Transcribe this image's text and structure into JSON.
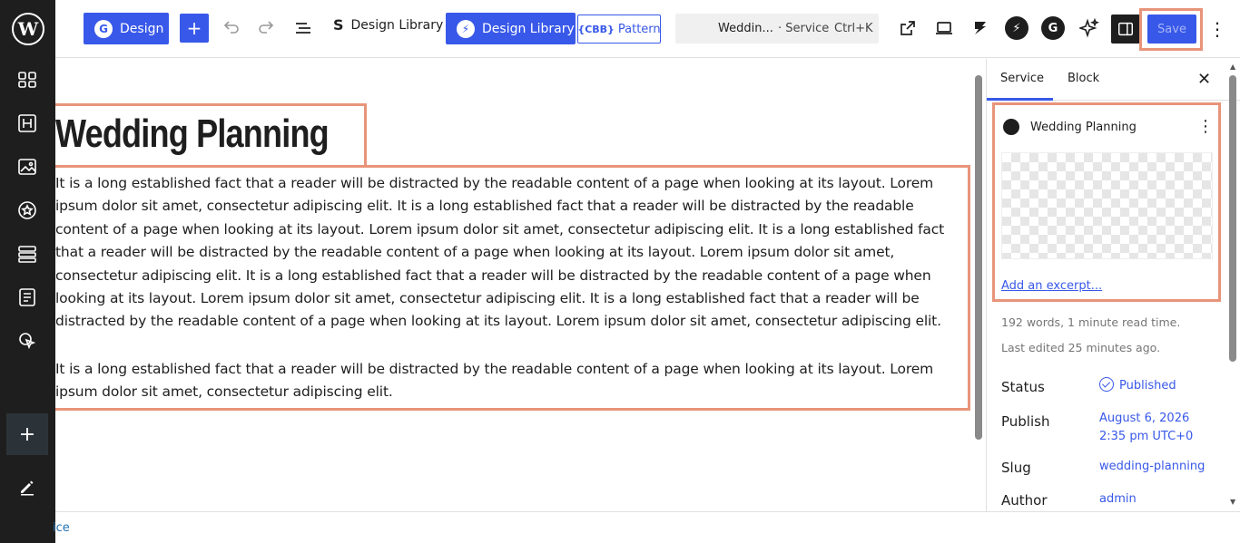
{
  "toolbar": {
    "design_label": "Design",
    "design_library_label": "Design Library",
    "design_library_active_label": "Design Library",
    "pattern_label": "Pattern",
    "pattern_prefix": "CBB",
    "command": {
      "title": "Weddin...",
      "type": "· Service",
      "shortcut": "Ctrl+K"
    },
    "save_label": "Save"
  },
  "editor": {
    "heading": "Wedding Planning",
    "paragraph1": "It is a long established fact that a reader will be distracted by the readable content of a page when looking at its layout. Lorem ipsum dolor sit amet, consectetur adipiscing elit. It is a long established fact that a reader will be distracted by the readable content of a page when looking at its layout. Lorem ipsum dolor sit amet, consectetur adipiscing elit. It is a long established fact that a reader will be distracted by the readable content of a page when looking at its layout. Lorem ipsum dolor sit amet, consectetur adipiscing elit. It is a long established fact that a reader will be distracted by the readable content of a page when looking at its layout. Lorem ipsum dolor sit amet, consectetur adipiscing elit. It is a long established fact that a reader will be distracted by the readable content of a page when looking at its layout. Lorem ipsum dolor sit amet, consectetur adipiscing elit.",
    "paragraph2": "It is a long established fact that a reader will be distracted by the readable content of a page when looking at its layout. Lorem ipsum dolor sit amet, consectetur adipiscing elit."
  },
  "footer": {
    "breadcrumb": "ice"
  },
  "panel": {
    "tabs": [
      {
        "label": "Service"
      },
      {
        "label": "Block"
      }
    ],
    "card_title": "Wedding Planning",
    "excerpt_link": "Add an excerpt...",
    "word_count": "192 words, 1 minute read time.",
    "last_edited": "Last edited 25 minutes ago.",
    "rows": {
      "status_label": "Status",
      "status_value": "Published",
      "publish_label": "Publish",
      "publish_date": "August 6, 2026",
      "publish_time": "2:35 pm UTC+0",
      "slug_label": "Slug",
      "slug_value": "wedding-planning",
      "author_label": "Author",
      "author_value": "admin"
    }
  },
  "colors": {
    "accent": "#3858e9",
    "highlight": "#e8947a",
    "sidebar": "#1e1e1e"
  }
}
